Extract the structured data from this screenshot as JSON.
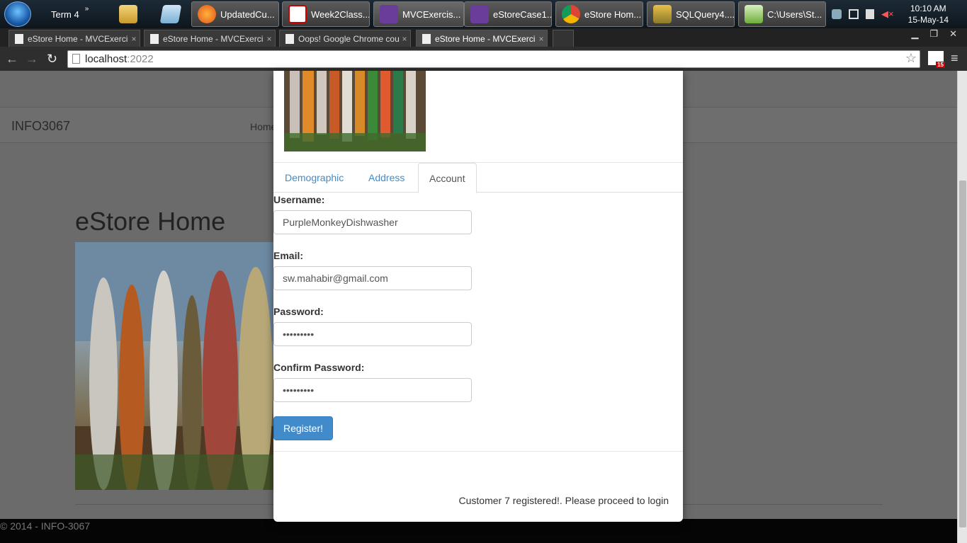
{
  "taskbar": {
    "pinned_label": "Term 4",
    "windows": [
      {
        "label": "UpdatedCu...",
        "icon": "firefox-icon"
      },
      {
        "label": "Week2Class...",
        "icon": "pdf-icon"
      },
      {
        "label": "MVCExercis...",
        "icon": "visual-studio-icon"
      },
      {
        "label": "eStoreCase1...",
        "icon": "visual-studio-icon"
      },
      {
        "label": "eStore Hom...",
        "icon": "chrome-icon"
      },
      {
        "label": "SQLQuery4....",
        "icon": "sql-server-icon"
      },
      {
        "label": "C:\\Users\\St...",
        "icon": "notepad-plus-icon"
      }
    ],
    "clock": {
      "time": "10:10 AM",
      "date": "15-May-14"
    }
  },
  "browser": {
    "tabs": [
      {
        "title": "eStore Home - MVCExerci"
      },
      {
        "title": "eStore Home - MVCExerci"
      },
      {
        "title": "Oops! Google Chrome cou"
      },
      {
        "title": "eStore Home - MVCExerci"
      }
    ],
    "url_host": "localhost",
    "url_port": ":2022",
    "extension_badge": "15"
  },
  "site": {
    "brand": "INFO3067",
    "nav_home": "Home",
    "heading": "eStore Home",
    "footer": "© 2014 - INFO-3067"
  },
  "modal": {
    "tabs": [
      "Demographic",
      "Address",
      "Account"
    ],
    "active_tab": "Account",
    "username_label": "Username:",
    "username_value": "PurpleMonkeyDishwasher",
    "email_label": "Email:",
    "email_value": "sw.mahabir@gmail.com",
    "password_label": "Password:",
    "password_value": "•••••••••",
    "confirm_label": "Confirm Password:",
    "confirm_value": "•••••••••",
    "register_label": "Register!",
    "status": "Customer 7 registered!. Please proceed to login"
  },
  "colors": {
    "accent": "#428bca",
    "overlay": "#6b6b6b"
  }
}
